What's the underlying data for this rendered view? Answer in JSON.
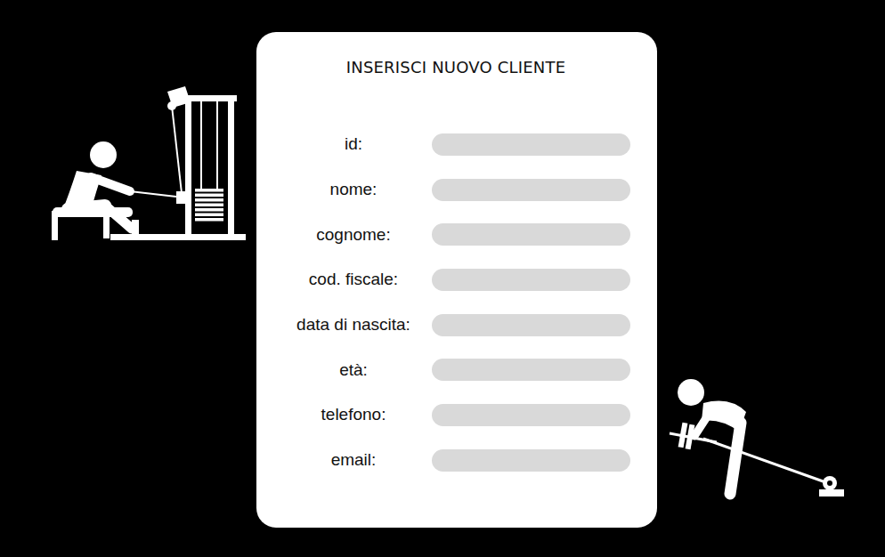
{
  "form": {
    "title": "INSERISCI NUOVO CLIENTE",
    "fields": [
      {
        "label": "id:"
      },
      {
        "label": "nome:"
      },
      {
        "label": "cognome:"
      },
      {
        "label": "cod. fiscale:"
      },
      {
        "label": "data di nascita:"
      },
      {
        "label": "età:"
      },
      {
        "label": "telefono:"
      },
      {
        "label": "email:"
      }
    ]
  }
}
